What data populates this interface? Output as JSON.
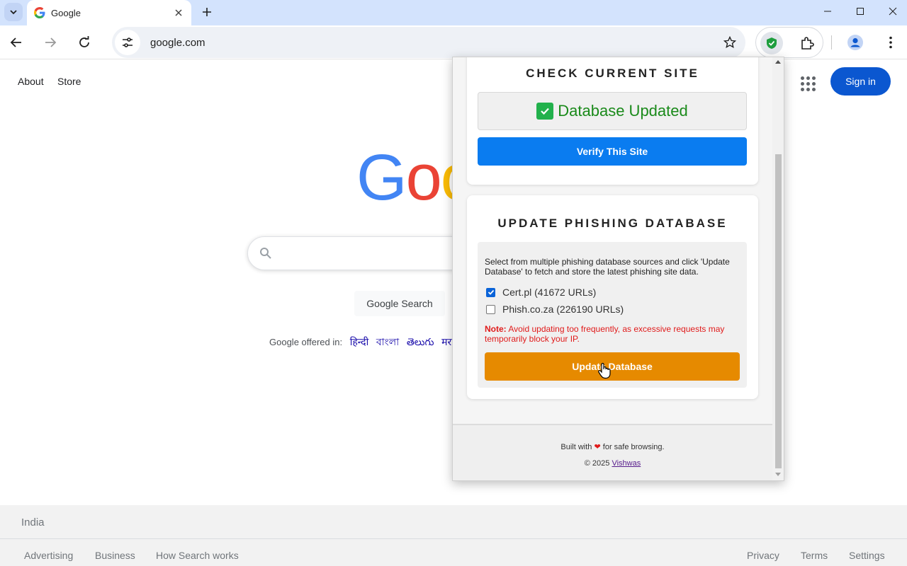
{
  "browser": {
    "tab_title": "Google",
    "url": "google.com"
  },
  "google": {
    "top_links": [
      "About",
      "Store"
    ],
    "signin_label": "Sign in",
    "logo_text": "Goo",
    "search_button": "Google Search",
    "offered_label": "Google offered in:",
    "languages": [
      "हिन्दी",
      "বাংলা",
      "తెలుగు",
      "मरा"
    ],
    "footer_country": "India",
    "footer_left": [
      "Advertising",
      "Business",
      "How Search works"
    ],
    "footer_right": [
      "Privacy",
      "Terms",
      "Settings"
    ]
  },
  "popup": {
    "check_title": "CHECK CURRENT SITE",
    "status_text": "Database Updated",
    "verify_button": "Verify This Site",
    "update_title": "UPDATE PHISHING DATABASE",
    "update_description": "Select from multiple phishing database sources and click 'Update Database' to fetch and store the latest phishing site data.",
    "sources": [
      {
        "label": "Cert.pl (41672 URLs)",
        "checked": true
      },
      {
        "label": "Phish.co.za (226190 URLs)",
        "checked": false
      }
    ],
    "note_label": "Note:",
    "note_text": "Avoid updating too frequently, as excessive requests may temporarily block your IP.",
    "update_button": "Update Database",
    "footer_built_prefix": "Built with",
    "footer_built_suffix": "for safe browsing.",
    "footer_copy": "© 2025",
    "footer_author": "Vishwas"
  },
  "colors": {
    "signin_bg": "#0b57d0",
    "verify_bg": "#0a7cf0",
    "update_bg": "#e68a00",
    "status_green": "#1a8a1a",
    "note_red": "#e01a1a"
  }
}
